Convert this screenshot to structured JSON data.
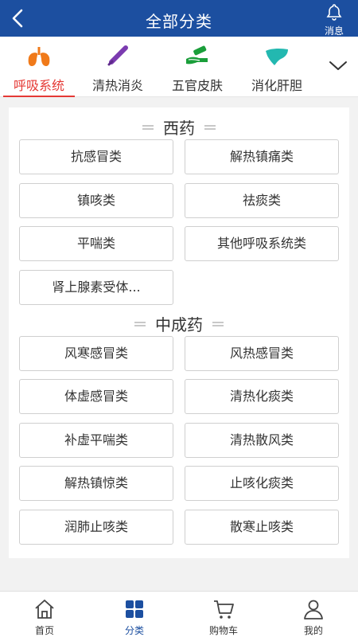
{
  "header": {
    "title": "全部分类",
    "message_label": "消息"
  },
  "tabs": [
    {
      "label": "呼吸系统",
      "icon": "lungs-icon",
      "active": true
    },
    {
      "label": "清热消炎",
      "icon": "thermometer-icon",
      "active": false
    },
    {
      "label": "五官皮肤",
      "icon": "hand-cream-icon",
      "active": false
    },
    {
      "label": "消化肝胆",
      "icon": "liver-icon",
      "active": false
    }
  ],
  "sections": [
    {
      "title": "西药",
      "items": [
        "抗感冒类",
        "解热镇痛类",
        "镇咳类",
        "祛痰类",
        "平喘类",
        "其他呼吸系统类",
        "肾上腺素受体..."
      ]
    },
    {
      "title": "中成药",
      "items": [
        "风寒感冒类",
        "风热感冒类",
        "体虚感冒类",
        "清热化痰类",
        "补虚平喘类",
        "清热散风类",
        "解热镇惊类",
        "止咳化痰类",
        "润肺止咳类",
        "散寒止咳类"
      ]
    }
  ],
  "bottom_nav": [
    {
      "label": "首页",
      "icon": "home-icon",
      "active": false
    },
    {
      "label": "分类",
      "icon": "category-grid-icon",
      "active": true
    },
    {
      "label": "购物车",
      "icon": "cart-icon",
      "active": false
    },
    {
      "label": "我的",
      "icon": "user-icon",
      "active": false
    }
  ],
  "colors": {
    "primary": "#1c4fa0",
    "active_tab": "#e53935",
    "background": "#f2f2f2"
  }
}
